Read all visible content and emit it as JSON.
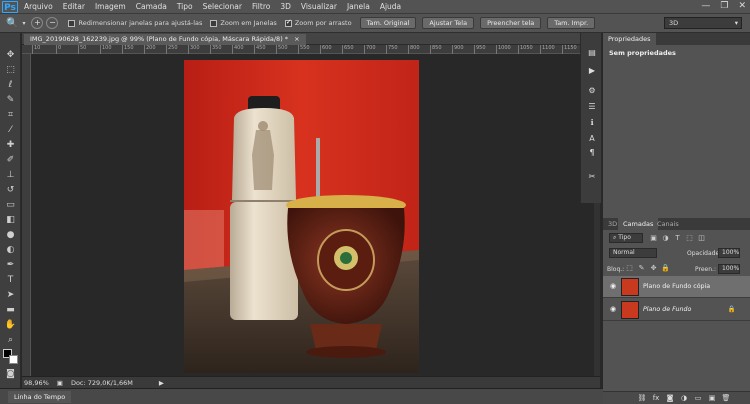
{
  "menubar": {
    "logo": "Ps",
    "items": [
      "Arquivo",
      "Editar",
      "Imagem",
      "Camada",
      "Tipo",
      "Selecionar",
      "Filtro",
      "3D",
      "Visualizar",
      "Janela",
      "Ajuda"
    ],
    "controls": [
      "—",
      "❐",
      "✕"
    ]
  },
  "options": {
    "zoom_icons": [
      "+",
      "−"
    ],
    "check_resize": "Redimensionar janelas para ajustá-las",
    "check_zoom_all": "Zoom em Janelas",
    "check_scrubby": "Zoom por arrasto",
    "btn_original": "Tam. Original",
    "btn_fit": "Ajustar Tela",
    "btn_fill": "Preencher tela",
    "btn_print": "Tam. Impr.",
    "workspace": "3D"
  },
  "document": {
    "tab_label": "IMG_20190628_162239.jpg @ 99% (Plano de Fundo cópia, Máscara Rápida/8) *",
    "close_glyph": "×",
    "ruler_ticks": [
      "10",
      "0",
      "50",
      "100",
      "150",
      "200",
      "250",
      "300",
      "350",
      "400",
      "450",
      "500",
      "550",
      "600",
      "650",
      "700",
      "750",
      "800",
      "850",
      "900",
      "950",
      "1000",
      "1050",
      "1100",
      "1150"
    ]
  },
  "status": {
    "zoom": "98,96%",
    "doc": "Doc: 729,0K/1,66M",
    "arrow": "▶"
  },
  "timeline": {
    "tab": "Linha do Tempo"
  },
  "properties": {
    "tab": "Propriedades",
    "content": "Sem propriedades"
  },
  "layers_panel": {
    "tabs": [
      "3D",
      "Camadas",
      "Canais"
    ],
    "kind": "Tipo",
    "blend_mode": "Normal",
    "opacity_label": "Opacidade:",
    "opacity_value": "100%",
    "lock_label": "Bloq.:",
    "fill_label": "Preen.:",
    "fill_value": "100%",
    "layers": [
      {
        "name": "Plano de Fundo cópia",
        "selected": true
      },
      {
        "name": "Plano de Fundo",
        "selected": false
      }
    ],
    "lock_icon": "🔒"
  }
}
